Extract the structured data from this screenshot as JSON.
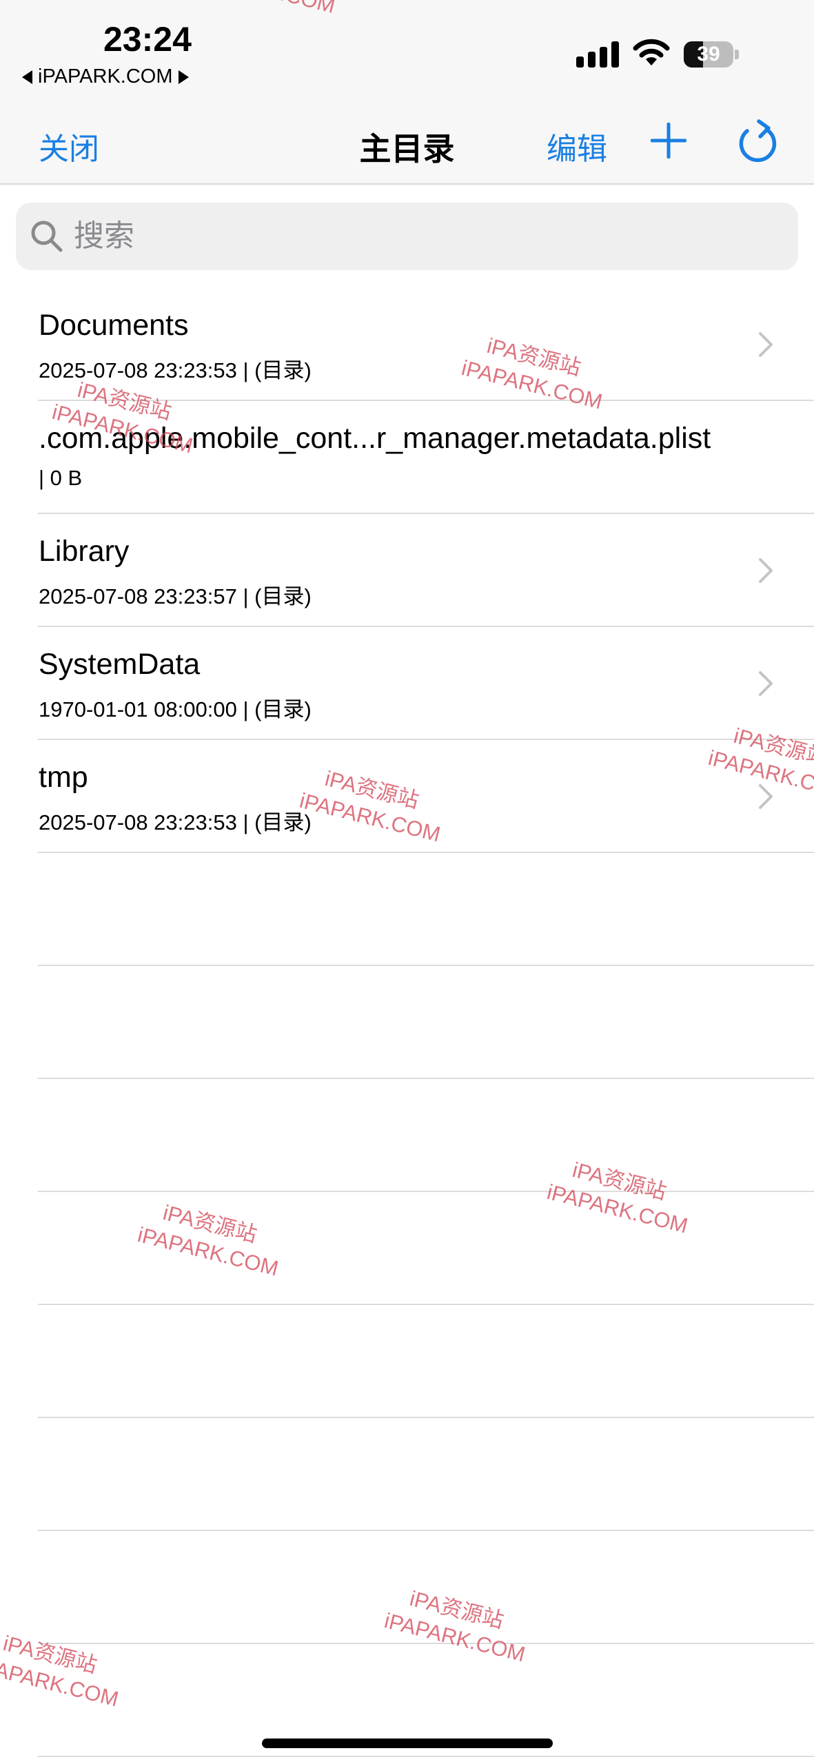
{
  "status_bar": {
    "time": "23:24",
    "back_app": "iPAPARK.COM",
    "battery_level": "39",
    "battery_fraction": 0.39
  },
  "nav": {
    "close_label": "关闭",
    "title": "主目录",
    "edit_label": "编辑"
  },
  "search": {
    "placeholder": "搜索",
    "value": ""
  },
  "files": [
    {
      "name": "Documents",
      "meta": "2025-07-08 23:23:53 | (目录)",
      "is_directory": true
    },
    {
      "name": ".com.apple.mobile_cont...r_manager.metadata.plist",
      "meta": "| 0 B",
      "is_directory": false
    },
    {
      "name": "Library",
      "meta": "2025-07-08 23:23:57 | (目录)",
      "is_directory": true
    },
    {
      "name": "SystemData",
      "meta": "1970-01-01 08:00:00 | (目录)",
      "is_directory": true
    },
    {
      "name": "tmp",
      "meta": "2025-07-08 23:23:53 | (目录)",
      "is_directory": true
    }
  ],
  "watermark": {
    "line1": "iPA资源站",
    "line2": "iPAPARK.COM",
    "partial_top": "RK.COM"
  },
  "colors": {
    "accent": "#1a7fe3",
    "watermark": "#d24655",
    "bar_background": "#f7f7f7",
    "search_background": "#efeff0",
    "separator": "#dcdcdc"
  }
}
